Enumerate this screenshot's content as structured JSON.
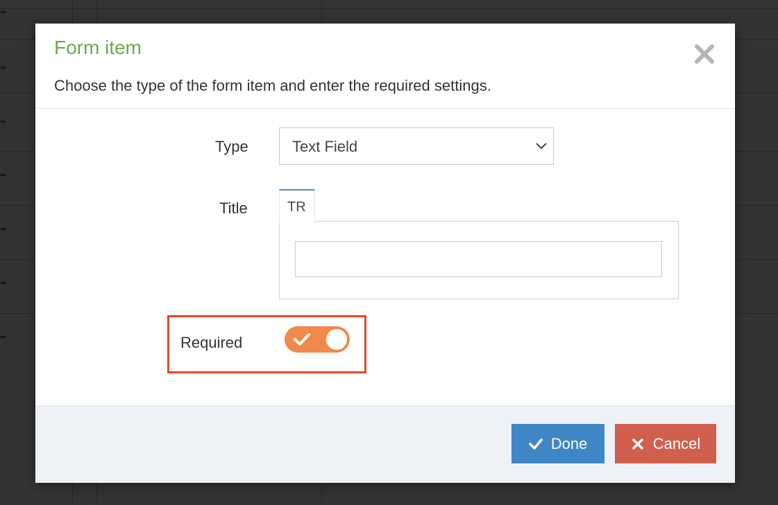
{
  "modal": {
    "title": "Form item",
    "subtitle": "Choose the type of the form item and enter the required settings.",
    "close_icon": "close-icon"
  },
  "form": {
    "type_label": "Type",
    "type_value": "Text Field",
    "title_label": "Title",
    "title_tab": "TR",
    "title_value": "",
    "required_label": "Required",
    "required_on": true
  },
  "footer": {
    "done_label": "Done",
    "cancel_label": "Cancel"
  },
  "colors": {
    "title": "#6aa84f",
    "toggle_on": "#f0894a",
    "done": "#3f86c6",
    "cancel": "#d0604c",
    "highlight": "#e8452c"
  }
}
